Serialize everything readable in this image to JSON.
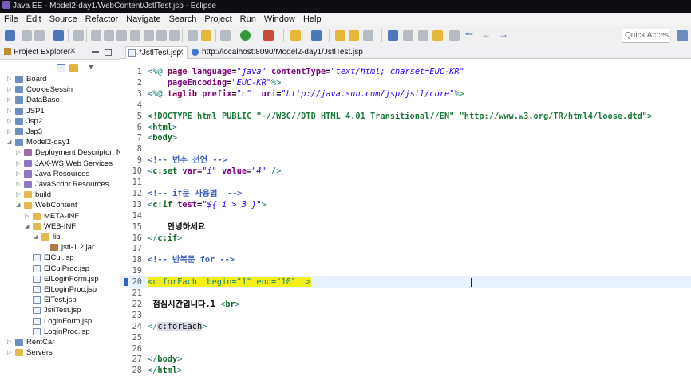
{
  "window": {
    "title": "Java EE - Model2-day1/WebContent/JstlTest.jsp - Eclipse"
  },
  "menu": [
    "File",
    "Edit",
    "Source",
    "Refactor",
    "Navigate",
    "Search",
    "Project",
    "Run",
    "Window",
    "Help"
  ],
  "toolbar": {
    "quick_access_placeholder": "Quick Access"
  },
  "explorer": {
    "title": "Project Explorer",
    "items": [
      {
        "label": "Board",
        "depth": 0,
        "icon": "project-icon",
        "expanded": false
      },
      {
        "label": "CookieSessin",
        "depth": 0,
        "icon": "project-icon",
        "expanded": false
      },
      {
        "label": "DataBase",
        "depth": 0,
        "icon": "project-icon",
        "expanded": false
      },
      {
        "label": "JSP1",
        "depth": 0,
        "icon": "project-icon",
        "expanded": false
      },
      {
        "label": "Jsp2",
        "depth": 0,
        "icon": "project-icon",
        "expanded": false
      },
      {
        "label": "Jsp3",
        "depth": 0,
        "icon": "project-icon",
        "expanded": false
      },
      {
        "label": "Model2-day1",
        "depth": 0,
        "icon": "project-icon",
        "expanded": true
      },
      {
        "label": "Deployment Descriptor: N",
        "depth": 1,
        "icon": "descriptor-icon",
        "expanded": false
      },
      {
        "label": "JAX-WS Web Services",
        "depth": 1,
        "icon": "webservice-icon",
        "expanded": false
      },
      {
        "label": "Java Resources",
        "depth": 1,
        "icon": "java-resources-icon",
        "expanded": false
      },
      {
        "label": "JavaScript Resources",
        "depth": 1,
        "icon": "javascript-resources-icon",
        "expanded": false
      },
      {
        "label": "build",
        "depth": 1,
        "icon": "folder-icon",
        "expanded": false
      },
      {
        "label": "WebContent",
        "depth": 1,
        "icon": "folder-icon",
        "expanded": true
      },
      {
        "label": "META-INF",
        "depth": 2,
        "icon": "folder-icon",
        "expanded": false
      },
      {
        "label": "WEB-INF",
        "depth": 2,
        "icon": "folder-icon",
        "expanded": true
      },
      {
        "label": "lib",
        "depth": 3,
        "icon": "folder-icon",
        "expanded": true
      },
      {
        "label": "jstl-1.2.jar",
        "depth": 4,
        "icon": "jar-icon",
        "expanded": null
      },
      {
        "label": "ElCul.jsp",
        "depth": 2,
        "icon": "jsp-file-icon",
        "expanded": null
      },
      {
        "label": "ElCulProc.jsp",
        "depth": 2,
        "icon": "jsp-file-icon",
        "expanded": null
      },
      {
        "label": "ElLoginForm.jsp",
        "depth": 2,
        "icon": "jsp-file-icon",
        "expanded": null
      },
      {
        "label": "ElLoginProc.jsp",
        "depth": 2,
        "icon": "jsp-file-icon",
        "expanded": null
      },
      {
        "label": "ElTest.jsp",
        "depth": 2,
        "icon": "jsp-file-icon",
        "expanded": null
      },
      {
        "label": "JstlTest.jsp",
        "depth": 2,
        "icon": "jsp-file-icon",
        "expanded": null
      },
      {
        "label": "LoginForm.jsp",
        "depth": 2,
        "icon": "jsp-file-icon",
        "expanded": null
      },
      {
        "label": "LoginProc.jsp",
        "depth": 2,
        "icon": "jsp-file-icon",
        "expanded": null
      },
      {
        "label": "RentCar",
        "depth": 0,
        "icon": "project-icon",
        "expanded": false
      },
      {
        "label": "Servers",
        "depth": 0,
        "icon": "folder-icon",
        "expanded": false
      }
    ]
  },
  "editor": {
    "tabs": [
      {
        "label": "*JstlTest.jsp",
        "active": true
      },
      {
        "label": "http://localhost:8090/Model2-day1/JstlTest.jsp",
        "active": false
      }
    ],
    "current_line": "20",
    "lines": [
      {
        "n": "1",
        "segs": [
          [
            "tag",
            "<%@ "
          ],
          [
            "kw",
            "page "
          ],
          [
            "attr",
            "language"
          ],
          [
            "plain",
            "="
          ],
          [
            "str",
            "\"java\""
          ],
          [
            "plain",
            " "
          ],
          [
            "attr",
            "contentType"
          ],
          [
            "plain",
            "="
          ],
          [
            "str",
            "\"text/html; charset=EUC-KR\""
          ]
        ]
      },
      {
        "n": "2",
        "segs": [
          [
            "plain",
            "    "
          ],
          [
            "attr",
            "pageEncoding"
          ],
          [
            "plain",
            "="
          ],
          [
            "str",
            "\"EUC-KR\""
          ],
          [
            "tag",
            "%>"
          ]
        ]
      },
      {
        "n": "3",
        "segs": [
          [
            "tag",
            "<%@ "
          ],
          [
            "kw",
            "taglib "
          ],
          [
            "attr",
            "prefix"
          ],
          [
            "plain",
            "="
          ],
          [
            "str",
            "\"c\""
          ],
          [
            "plain",
            "  "
          ],
          [
            "attr",
            "uri"
          ],
          [
            "plain",
            "="
          ],
          [
            "str",
            "\"http://java.sun.com/jsp/jstl/core\""
          ],
          [
            "tag",
            "%>"
          ]
        ]
      },
      {
        "n": "4",
        "segs": []
      },
      {
        "n": "5",
        "segs": [
          [
            "doctype",
            "<!DOCTYPE html PUBLIC \"-//W3C//DTD HTML 4.01 Transitional//EN\" \"http://www.w3.org/TR/html4/loose.dtd\">"
          ]
        ]
      },
      {
        "n": "6",
        "segs": [
          [
            "tag",
            "<"
          ],
          [
            "el",
            "html"
          ],
          [
            "tag",
            ">"
          ]
        ]
      },
      {
        "n": "7",
        "segs": [
          [
            "tag",
            "<"
          ],
          [
            "el",
            "body"
          ],
          [
            "tag",
            ">"
          ]
        ]
      },
      {
        "n": "8",
        "segs": []
      },
      {
        "n": "9",
        "segs": [
          [
            "cmt",
            "<!-- 변수 선언 -->"
          ]
        ]
      },
      {
        "n": "10",
        "segs": [
          [
            "tag",
            "<"
          ],
          [
            "el",
            "c:set "
          ],
          [
            "attr",
            "var"
          ],
          [
            "plain",
            "="
          ],
          [
            "str",
            "\"i\""
          ],
          [
            "plain",
            " "
          ],
          [
            "attr",
            "value"
          ],
          [
            "plain",
            "="
          ],
          [
            "str",
            "\"4\""
          ],
          [
            "plain",
            " "
          ],
          [
            "tag",
            "/>"
          ]
        ]
      },
      {
        "n": "11",
        "segs": []
      },
      {
        "n": "12",
        "segs": [
          [
            "cmt",
            "<!-- if문 사용법  -->"
          ]
        ]
      },
      {
        "n": "13",
        "segs": [
          [
            "tag",
            "<"
          ],
          [
            "el",
            "c:if "
          ],
          [
            "attr",
            "test"
          ],
          [
            "plain",
            "="
          ],
          [
            "str",
            "\"${ i > 3 }\""
          ],
          [
            "tag",
            ">"
          ]
        ]
      },
      {
        "n": "14",
        "segs": []
      },
      {
        "n": "15",
        "segs": [
          [
            "plain",
            "    안녕하세요"
          ]
        ]
      },
      {
        "n": "16",
        "segs": [
          [
            "tag",
            "</"
          ],
          [
            "el",
            "c:if"
          ],
          [
            "tag",
            ">"
          ]
        ]
      },
      {
        "n": "17",
        "segs": []
      },
      {
        "n": "18",
        "segs": [
          [
            "cmt",
            "<!-- 반복문 for -->"
          ]
        ]
      },
      {
        "n": "19",
        "segs": []
      },
      {
        "n": "20",
        "segs": [
          [
            "sel",
            "<c:forEach  begin=\"1\" end=\"10\"  >"
          ]
        ]
      },
      {
        "n": "21",
        "segs": []
      },
      {
        "n": "22",
        "segs": [
          [
            "plain",
            " 점심시간입니다.1 "
          ],
          [
            "tag",
            "<"
          ],
          [
            "el",
            "br"
          ],
          [
            "tag",
            ">"
          ]
        ]
      },
      {
        "n": "23",
        "segs": []
      },
      {
        "n": "24",
        "segs": [
          [
            "tag",
            "</"
          ],
          [
            "hl",
            "c:forEach"
          ],
          [
            "tag",
            ">"
          ]
        ]
      },
      {
        "n": "25",
        "segs": []
      },
      {
        "n": "26",
        "segs": []
      },
      {
        "n": "27",
        "segs": [
          [
            "tag",
            "</"
          ],
          [
            "el",
            "body"
          ],
          [
            "tag",
            ">"
          ]
        ]
      },
      {
        "n": "28",
        "segs": [
          [
            "tag",
            "</"
          ],
          [
            "el",
            "html"
          ],
          [
            "tag",
            ">"
          ]
        ]
      }
    ]
  }
}
